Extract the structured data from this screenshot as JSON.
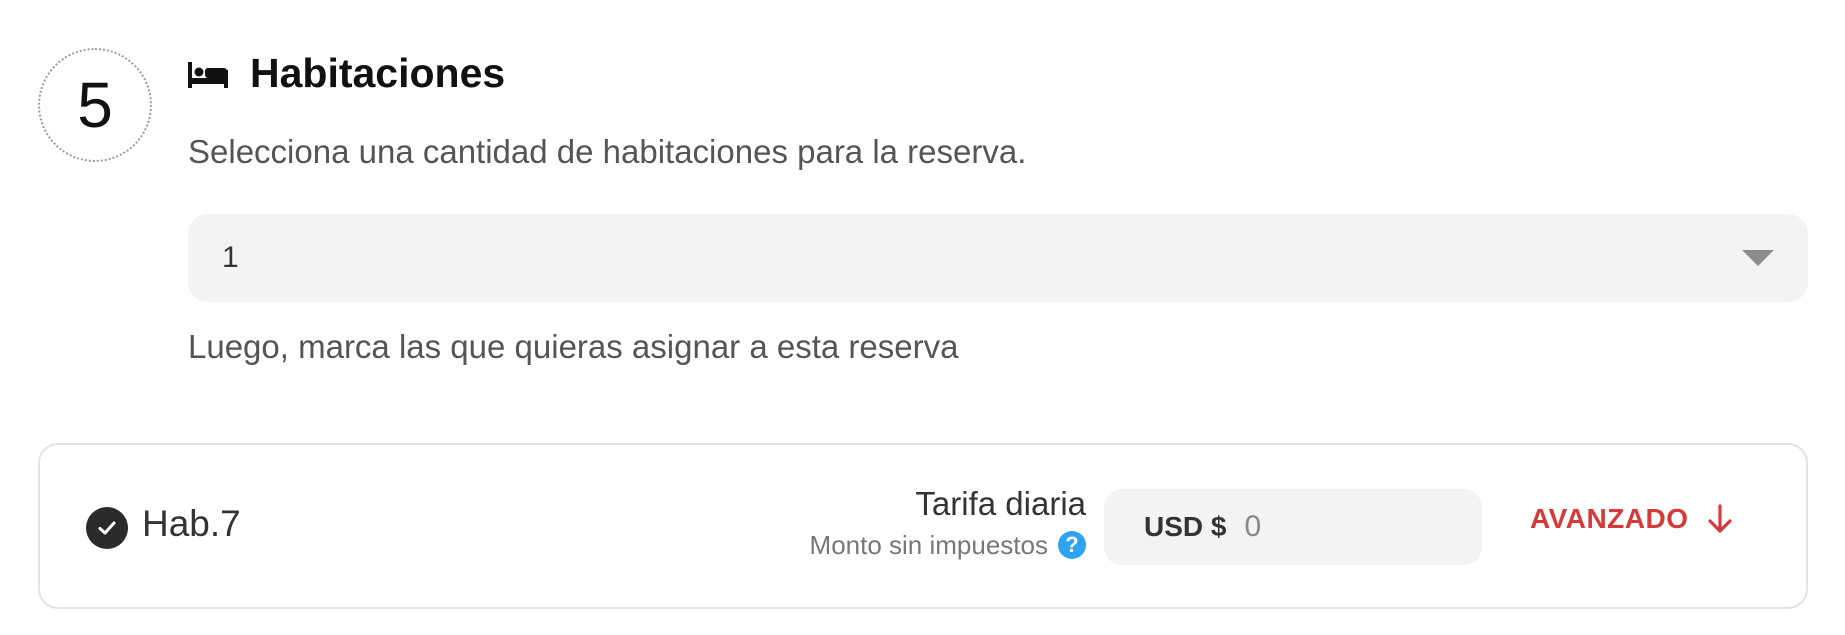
{
  "step": {
    "number": "5"
  },
  "header": {
    "icon": "bed-icon",
    "title": "Habitaciones"
  },
  "subtitle": "Selecciona una cantidad de habitaciones para la reserva.",
  "room_count_select": {
    "value": "1"
  },
  "hint": "Luego, marca las que quieras asignar a esta reserva",
  "rooms": [
    {
      "name": "Hab.7",
      "checked": true,
      "rate_label": "Tarifa diaria",
      "rate_sublabel": "Monto sin impuestos",
      "currency": "USD $",
      "price": "0",
      "advanced_label": "AVANZADO"
    }
  ],
  "colors": {
    "accent_red": "#d43a3a",
    "help_blue": "#2ea3f2",
    "field_bg": "#f2f3f4"
  }
}
